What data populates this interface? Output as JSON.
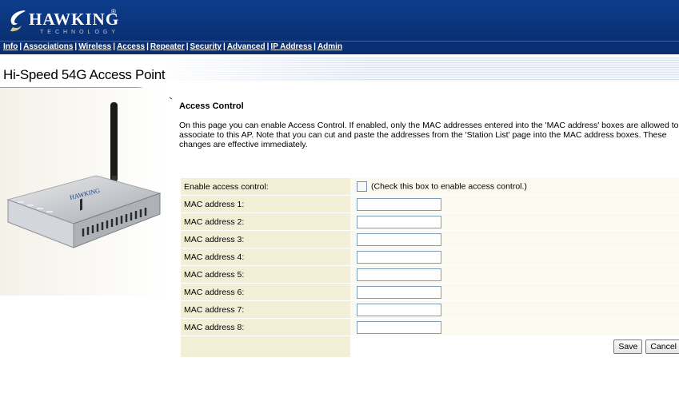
{
  "brand": {
    "name": "HAWKING",
    "reg": "®",
    "tagline": "TECHNOLOGY"
  },
  "nav": {
    "items": [
      {
        "label": "Info"
      },
      {
        "label": "Associations"
      },
      {
        "label": "Wireless"
      },
      {
        "label": "Access"
      },
      {
        "label": "Repeater"
      },
      {
        "label": "Security"
      },
      {
        "label": "Advanced"
      },
      {
        "label": "IP Address"
      },
      {
        "label": "Admin"
      }
    ],
    "separator": "|"
  },
  "page": {
    "title": "Hi-Speed 54G Access Point"
  },
  "content": {
    "heading": "Access Control",
    "description": "On this page you can enable Access Control. If enabled, only the MAC addresses entered into the 'MAC address' boxes are allowed to associate to this AP. Note that you can cut and paste the addresses from the 'Station List' page into the MAC address boxes. These changes are effective immediately."
  },
  "form": {
    "enable_label": "Enable access control:",
    "enable_hint": "(Check this box to enable access control.)",
    "enable_checked": false,
    "mac_rows": [
      {
        "label": "MAC address 1:",
        "value": ""
      },
      {
        "label": "MAC address 2:",
        "value": ""
      },
      {
        "label": "MAC address 3:",
        "value": ""
      },
      {
        "label": "MAC address 4:",
        "value": ""
      },
      {
        "label": "MAC address 5:",
        "value": ""
      },
      {
        "label": "MAC address 6:",
        "value": ""
      },
      {
        "label": "MAC address 7:",
        "value": ""
      },
      {
        "label": "MAC address 8:",
        "value": ""
      }
    ],
    "save_label": "Save",
    "cancel_label": "Cancel"
  },
  "colors": {
    "banner": "#0d3d8c",
    "label_bg": "#f3efd7",
    "value_bg": "#fbfaf1"
  },
  "icons": {
    "logo": "hawking-swoosh-icon",
    "product": "access-point-device-image"
  }
}
